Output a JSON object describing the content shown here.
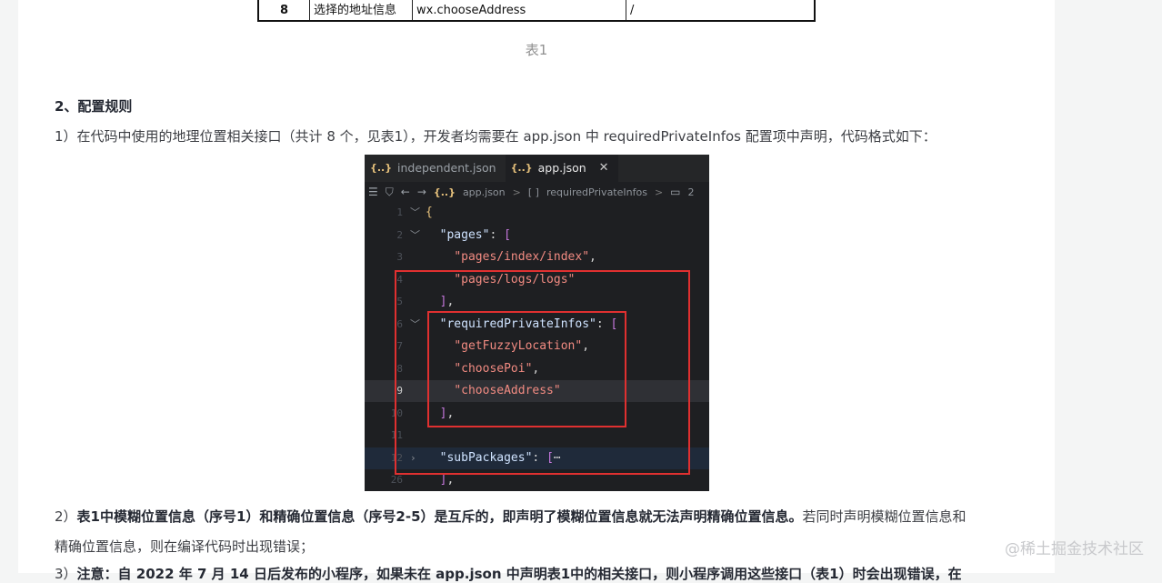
{
  "table_row": {
    "seq": "8",
    "name": "选择的地址信息",
    "api": "wx.chooseAddress",
    "note": "/"
  },
  "caption": "表1",
  "section_heading": "2、配置规则",
  "para1": "1）在代码中使用的地理位置相关接口（共计 8 个，见表1），开发者均需要在 app.json 中 requiredPrivateInfos 配置项中声明，代码格式如下：",
  "editor": {
    "tabs": [
      {
        "icon": "{..}",
        "label": "independent.json"
      },
      {
        "icon": "{..}",
        "label": "app.json",
        "close": "✕"
      }
    ],
    "breadcrumb": {
      "file": "app.json",
      "sep1": ">",
      "brackets": "[ ]",
      "field": "requiredPrivateInfos",
      "sep2": ">",
      "item": "2"
    },
    "lines": [
      {
        "n": "1",
        "fold": "﹀",
        "c": [
          [
            "brace",
            "{"
          ]
        ]
      },
      {
        "n": "2",
        "fold": "﹀",
        "c": [
          [
            "pun",
            "  "
          ],
          [
            "k",
            "\"pages\""
          ],
          [
            "pun",
            ": "
          ],
          [
            "brk",
            "["
          ]
        ]
      },
      {
        "n": "3",
        "c": [
          [
            "pun",
            "    "
          ],
          [
            "str",
            "\"pages/index/index\""
          ],
          [
            "pun",
            ","
          ]
        ]
      },
      {
        "n": "4",
        "c": [
          [
            "pun",
            "    "
          ],
          [
            "str",
            "\"pages/logs/logs\""
          ]
        ]
      },
      {
        "n": "5",
        "c": [
          [
            "pun",
            "  "
          ],
          [
            "brk",
            "]"
          ],
          [
            "pun",
            ","
          ]
        ]
      },
      {
        "n": "6",
        "fold": "﹀",
        "c": [
          [
            "pun",
            "  "
          ],
          [
            "k",
            "\"requiredPrivateInfos\""
          ],
          [
            "pun",
            ": "
          ],
          [
            "brk",
            "["
          ]
        ]
      },
      {
        "n": "7",
        "c": [
          [
            "pun",
            "    "
          ],
          [
            "str",
            "\"getFuzzyLocation\""
          ],
          [
            "pun",
            ","
          ]
        ]
      },
      {
        "n": "8",
        "c": [
          [
            "pun",
            "    "
          ],
          [
            "str",
            "\"choosePoi\""
          ],
          [
            "pun",
            ","
          ]
        ]
      },
      {
        "n": "9",
        "cur": true,
        "c": [
          [
            "pun",
            "    "
          ],
          [
            "str",
            "\"chooseAddress\""
          ]
        ]
      },
      {
        "n": "10",
        "c": [
          [
            "pun",
            "  "
          ],
          [
            "brk",
            "]"
          ],
          [
            "pun",
            ","
          ]
        ]
      },
      {
        "n": "11",
        "c": []
      },
      {
        "n": "12",
        "fold": "›",
        "blue": true,
        "c": [
          [
            "pun",
            "  "
          ],
          [
            "k",
            "\"subPackages\""
          ],
          [
            "pun",
            ": "
          ],
          [
            "brk",
            "["
          ],
          [
            "pun",
            "⋯"
          ]
        ]
      },
      {
        "n": "26",
        "c": [
          [
            "pun",
            "  "
          ],
          [
            "brk",
            "]"
          ],
          [
            "pun",
            ","
          ]
        ]
      }
    ]
  },
  "para2_bold": "表1中模糊位置信息（序号1）和精确位置信息（序号2-5）是互斥的，即声明了模糊位置信息就无法声明精确位置信息。",
  "para2_rest": "若同时声明模糊位置信息和",
  "para2_line2": "精确位置信息，则在编译代码时出现错误；",
  "para3_prefix": "3）",
  "para3_bold": "注意：自 2022 年 7 月 14 日后发布的小程序，如果未在 app.json 中声明表1中的相关接口，则小程序调用这些接口（表1）时会出现错误，在",
  "watermark": "@稀土掘金技术社区"
}
